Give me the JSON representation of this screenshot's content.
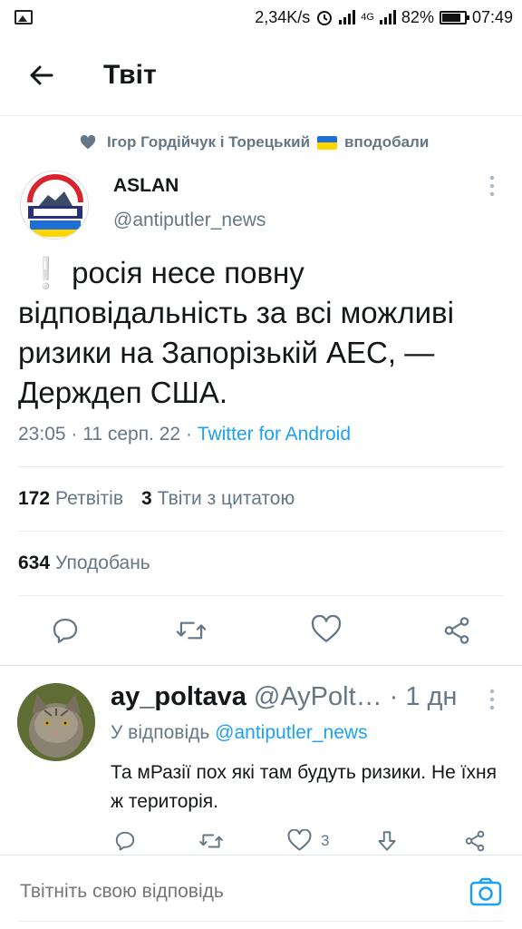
{
  "status_bar": {
    "speed": "2,34K/s",
    "network": "4G",
    "battery": "82%",
    "battery_level": 0.82,
    "time": "07:49"
  },
  "header": {
    "title": "Твіт"
  },
  "social_context": {
    "prefix": "Ігор Гордійчук і Торецький",
    "suffix": "вподобали"
  },
  "tweet": {
    "author_name": "ASLAN",
    "author_handle": "@antiputler_news",
    "text": "росія несе повну відповідальність за всі можливі ризики на Запорізькій АЕС, — Держдеп США.",
    "time": "23:05 · 11 серп. 22 · ",
    "source": "Twitter for Android",
    "retweets_count": "172",
    "retweets_label": "Ретвітів",
    "quotes_count": "3",
    "quotes_label": "Твіти з цитатою",
    "likes_count": "634",
    "likes_label": "Уподобань"
  },
  "reply": {
    "name": "ay_poltava",
    "handle": "@AyPolt…",
    "time": "1 дн",
    "reply_to_label": "У відповідь",
    "reply_to_handle": "@antiputler_news",
    "text": "Та мРазії пох які там будуть ризики. Не їхня ж територія.",
    "likes_count": "3"
  },
  "compose": {
    "placeholder": "Твітніть свою відповідь"
  },
  "colors": {
    "accent": "#1da1f2",
    "secondary_text": "#657786",
    "primary_text": "#14171a"
  }
}
